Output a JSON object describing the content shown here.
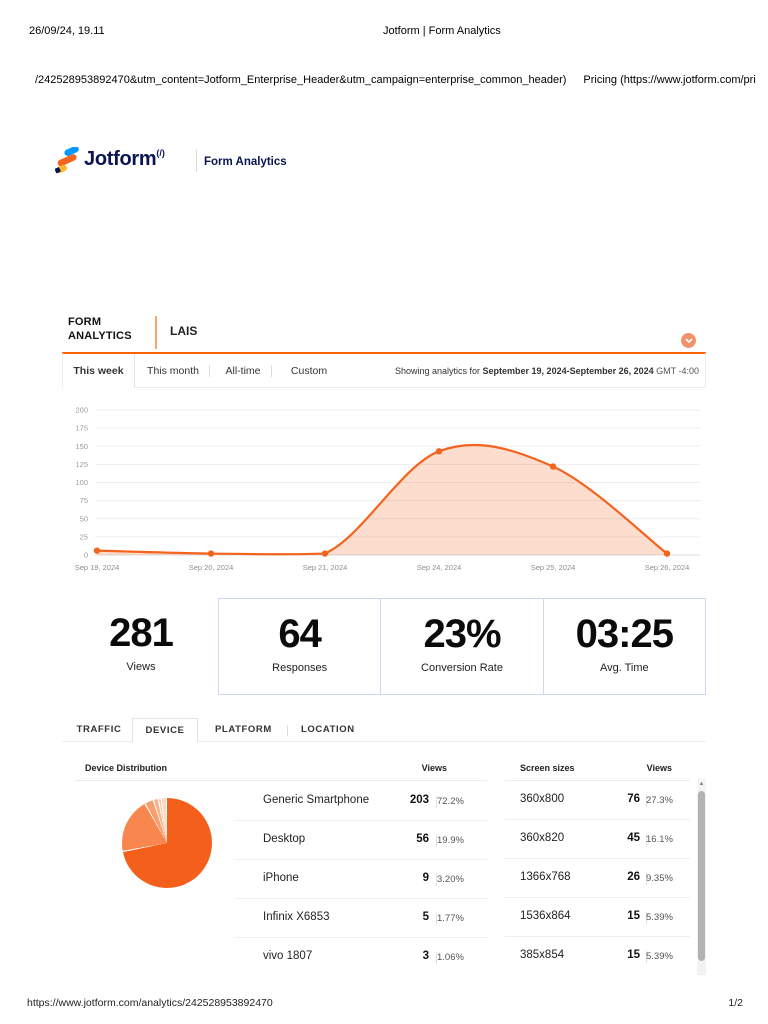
{
  "print_header": {
    "datetime": "26/09/24, 19.11",
    "document_title": "Jotform | Form Analytics",
    "url_line": "/242528953892470&utm_content=Jotform_Enterprise_Header&utm_campaign=enterprise_common_header)",
    "pricing_link": "Pricing (https://www.jotform.com/pri"
  },
  "brand": {
    "name": "Jotform",
    "suffix": "(/)",
    "product": "Form Analytics"
  },
  "selector": {
    "label_line1": "FORM",
    "label_line2": "ANALYTICS",
    "form_name": "LAIS"
  },
  "range_tabs": {
    "this_week": "This week",
    "this_month": "This month",
    "all_time": "All-time",
    "custom": "Custom"
  },
  "showing": {
    "prefix": "Showing analytics for ",
    "range": "September 19, 2024-September 26, 2024",
    "timezone": " GMT -4:00"
  },
  "chart_data": [
    {
      "type": "area",
      "title": "Views over time",
      "x": [
        "Sep 19, 2024",
        "Sep 20, 2024",
        "Sep 21, 2024",
        "Sep 24, 2024",
        "Sep 25, 2024",
        "Sep 26, 2024"
      ],
      "values": [
        6,
        2,
        2,
        143,
        122,
        2
      ],
      "ylim": [
        0,
        200
      ],
      "yticks": [
        0,
        25,
        50,
        75,
        100,
        125,
        150,
        175,
        200
      ],
      "grid": true,
      "legend": "none",
      "line_color": "#f3641e",
      "fill_color": "rgba(243,100,30,0.22)"
    },
    {
      "type": "pie",
      "title": "Device Distribution",
      "labels": [
        "Generic Smartphone",
        "Desktop",
        "iPhone",
        "Infinix X6853",
        "vivo 1807",
        "other"
      ],
      "values": [
        72.2,
        19.9,
        3.2,
        1.77,
        1.06,
        1.87
      ],
      "colors": [
        "#f4601c",
        "#f8874f",
        "#f99e6e",
        "#fab388",
        "#fbc7a6",
        "#fcd9c2"
      ]
    }
  ],
  "stats": {
    "views": {
      "value": "281",
      "label": "Views"
    },
    "responses": {
      "value": "64",
      "label": "Responses"
    },
    "conversion": {
      "value": "23%",
      "label": "Conversion Rate"
    },
    "avg_time": {
      "value": "03:25",
      "label": "Avg. Time"
    }
  },
  "detail_tabs": {
    "traffic": "TRAFFIC",
    "device": "DEVICE",
    "platform": "PLATFORM",
    "location": "LOCATION"
  },
  "device_panel": {
    "title": "Device Distribution",
    "views_header": "Views",
    "rows": [
      {
        "name": "Generic Smartphone",
        "count": "203",
        "pct": "72.2%"
      },
      {
        "name": "Desktop",
        "count": "56",
        "pct": "19.9%"
      },
      {
        "name": "iPhone",
        "count": "9",
        "pct": "3.20%"
      },
      {
        "name": "Infinix X6853",
        "count": "5",
        "pct": "1.77%"
      },
      {
        "name": "vivo 1807",
        "count": "3",
        "pct": "1.06%"
      }
    ]
  },
  "screen_panel": {
    "title": "Screen sizes",
    "views_header": "Views",
    "rows": [
      {
        "name": "360x800",
        "count": "76",
        "pct": "27.3%"
      },
      {
        "name": "360x820",
        "count": "45",
        "pct": "16.1%"
      },
      {
        "name": "1366x768",
        "count": "26",
        "pct": "9.35%"
      },
      {
        "name": "1536x864",
        "count": "15",
        "pct": "5.39%"
      },
      {
        "name": "385x854",
        "count": "15",
        "pct": "5.39%"
      }
    ]
  },
  "footer": {
    "url": "https://www.jotform.com/analytics/242528953892470",
    "page_indicator": "1/2"
  },
  "colors": {
    "accent": "#ff6100",
    "navy": "#0a1551",
    "chart_line": "#f3641e"
  }
}
